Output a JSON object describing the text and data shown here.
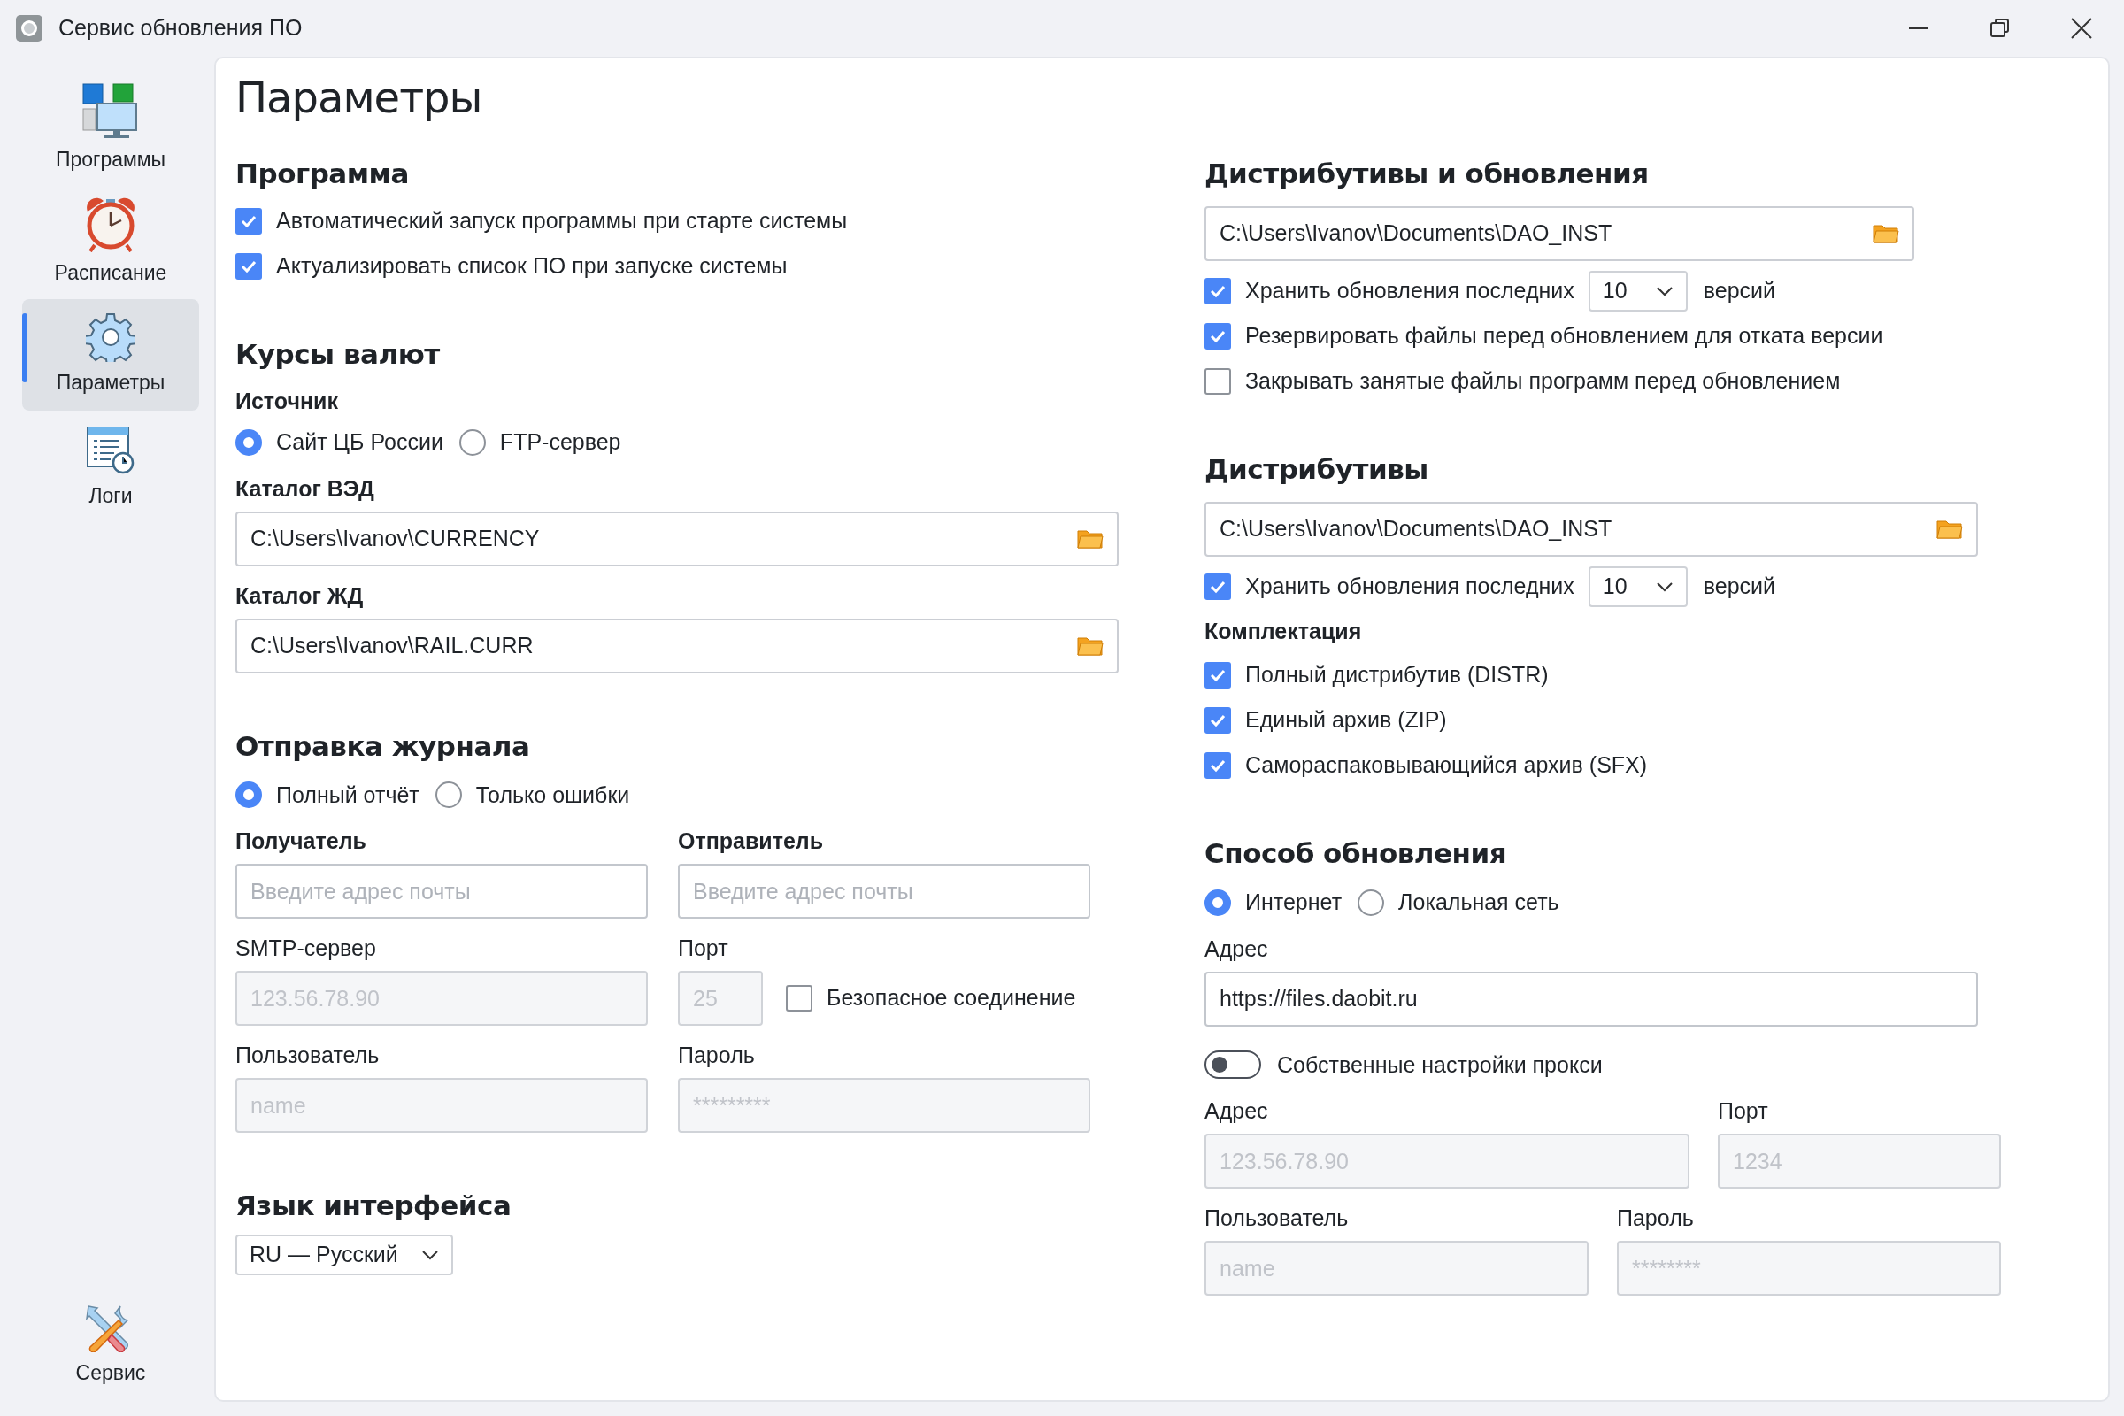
{
  "window": {
    "title": "Сервис обновления ПО"
  },
  "sidebar": {
    "items": [
      {
        "label": "Программы",
        "selected": false
      },
      {
        "label": "Расписание",
        "selected": false
      },
      {
        "label": "Параметры",
        "selected": true
      },
      {
        "label": "Логи",
        "selected": false
      }
    ],
    "bottom_item": {
      "label": "Сервис",
      "selected": false
    }
  },
  "page_title": "Параметры",
  "left_column": [
    {
      "heading": "Программа",
      "items": [
        {
          "kind": "checkbox",
          "label": "Автоматический запуск программы при старте системы",
          "checked": true
        },
        {
          "kind": "checkbox",
          "label": "Актуализировать список ПО при запуске системы",
          "checked": true
        }
      ]
    },
    {
      "heading": "Курсы валют",
      "items": [
        {
          "kind": "radios",
          "label": "Источник",
          "options": [
            {
              "label": "Сайт ЦБ России",
              "selected": true
            },
            {
              "label": "FTP-сервер",
              "selected": false
            }
          ]
        },
        {
          "kind": "path",
          "label": "Каталог ВЭД",
          "value": "C:\\Users\\Ivanov\\CURRENCY"
        },
        {
          "kind": "path",
          "label": "Каталог ЖД",
          "value": "C:\\Users\\Ivanov\\RAIL.CURR"
        }
      ]
    },
    {
      "heading": "Отправка журнала",
      "items": [
        {
          "kind": "radios",
          "options": [
            {
              "label": "Полный отчёт",
              "selected": true
            },
            {
              "label": "Только ошибки",
              "selected": false
            }
          ]
        },
        {
          "kind": "fields",
          "fields": [
            {
              "label": "Получатель",
              "bold": true,
              "placeholder": "Введите адрес почты",
              "disabled": false
            },
            {
              "label": "Отправитель",
              "bold": true,
              "placeholder": "Введите адрес почты",
              "disabled": false
            }
          ]
        },
        {
          "kind": "fields",
          "fields": [
            {
              "label": "SMTP-сервер",
              "bold": false,
              "placeholder": "123.56.78.90",
              "disabled": true
            },
            {
              "label": "Порт",
              "bold": false,
              "placeholder": "25",
              "disabled": true,
              "checkbox": {
                "label": "Безопасное соединение",
                "checked": false
              }
            }
          ]
        },
        {
          "kind": "fields",
          "fields": [
            {
              "label": "Пользователь",
              "bold": false,
              "placeholder": "name",
              "disabled": true
            },
            {
              "label": "Пароль",
              "bold": false,
              "placeholder": "*********",
              "disabled": true
            }
          ]
        }
      ]
    },
    {
      "heading": "Язык интерфейса",
      "items": [
        {
          "kind": "select",
          "value": "RU — Русский"
        }
      ]
    }
  ],
  "right_column": [
    {
      "heading": "Дистрибутивы и обновления",
      "items": [
        {
          "kind": "path",
          "value": "C:\\Users\\Ivanov\\Documents\\DAO_INST"
        },
        {
          "kind": "versions",
          "label": "Хранить обновления последних",
          "checked": true,
          "value": "10",
          "suffix": "версий"
        },
        {
          "kind": "checkbox",
          "label": "Резервировать файлы перед обновлением для отката версии",
          "checked": true
        },
        {
          "kind": "checkbox",
          "label": "Закрывать занятые файлы программ перед обновлением",
          "checked": false
        }
      ]
    },
    {
      "heading": "Дистрибутивы",
      "items": [
        {
          "kind": "path",
          "value": "C:\\Users\\Ivanov\\Documents\\DAO_INST"
        },
        {
          "kind": "versions",
          "label": "Хранить обновления последних",
          "checked": true,
          "value": "10",
          "suffix": "версий"
        },
        {
          "kind": "label",
          "text": "Комплектация"
        },
        {
          "kind": "checkbox",
          "label": "Полный дистрибутив (DISTR)",
          "checked": true
        },
        {
          "kind": "checkbox",
          "label": "Единый архив (ZIP)",
          "checked": true
        },
        {
          "kind": "checkbox",
          "label": "Самораспаковывающийся архив (SFX)",
          "checked": true
        }
      ]
    },
    {
      "heading": "Способ обновления",
      "items": [
        {
          "kind": "radios",
          "options": [
            {
              "label": "Интернет",
              "selected": true
            },
            {
              "label": "Локальная сеть",
              "selected": false
            }
          ]
        },
        {
          "kind": "input",
          "label": "Адрес",
          "value": "https://files.daobit.ru"
        },
        {
          "kind": "toggle",
          "label": "Собственные настройки прокси",
          "on": false
        },
        {
          "kind": "fields",
          "fields": [
            {
              "label": "Адрес",
              "bold": false,
              "placeholder": "123.56.78.90",
              "disabled": true
            },
            {
              "label": "Порт",
              "bold": false,
              "placeholder": "1234",
              "disabled": true
            }
          ]
        },
        {
          "kind": "fields",
          "fields": [
            {
              "label": "Пользователь",
              "bold": false,
              "placeholder": "name",
              "disabled": true
            },
            {
              "label": "Пароль",
              "bold": false,
              "placeholder": "********",
              "disabled": true
            }
          ]
        }
      ]
    }
  ]
}
